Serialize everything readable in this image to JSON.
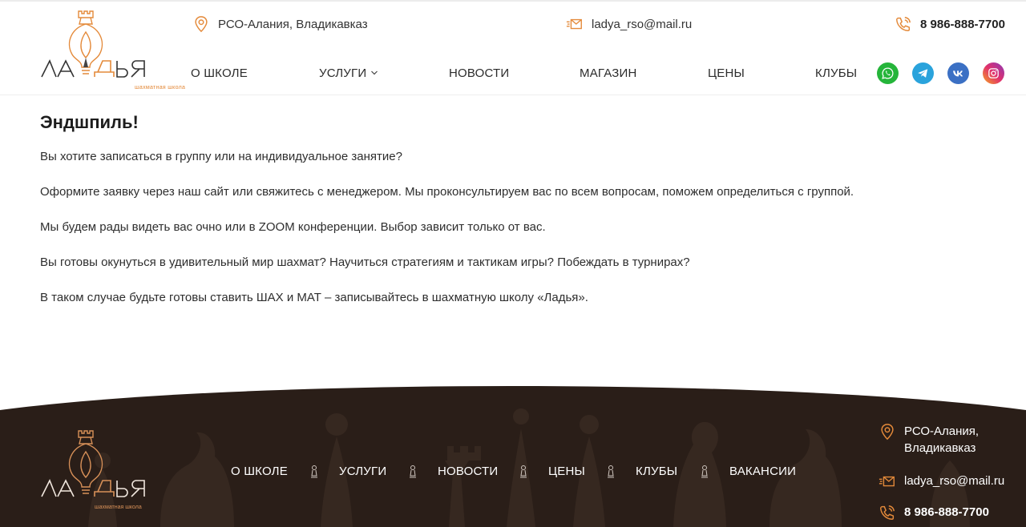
{
  "header": {
    "logo": {
      "brand": "ЛАДЬЯ",
      "tagline": "шахматная школа",
      "accent": "#e48a3a"
    },
    "address": "РСО-Алания, Владикавказ",
    "email": "ladya_rso@mail.ru",
    "phone": "8 986-888-7700",
    "nav": [
      {
        "label": "О ШКОЛЕ"
      },
      {
        "label": "УСЛУГИ",
        "has_dropdown": true
      },
      {
        "label": "НОВОСТИ"
      },
      {
        "label": "МАГАЗИН"
      },
      {
        "label": "ЦЕНЫ"
      },
      {
        "label": "КЛУБЫ"
      }
    ],
    "social": [
      {
        "icon": "whatsapp-icon",
        "color": "#25b53a"
      },
      {
        "icon": "telegram-icon",
        "color": "#2aa3dc"
      },
      {
        "icon": "vk-icon",
        "color": "#3b70c4"
      },
      {
        "icon": "instagram-icon",
        "color": "#d9307a"
      }
    ]
  },
  "main": {
    "title": "Эндшпиль!",
    "paragraphs": [
      "Вы хотите записаться в группу или на индивидуальное занятие?",
      "Оформите заявку через наш сайт или свяжитесь с менеджером. Мы проконсультируем вас по всем вопросам, поможем определиться с группой.",
      "Мы будем рады видеть вас очно или в ZOOM конференции. Выбор зависит только от вас.",
      "Вы готовы окунуться в удивительный мир шахмат? Научиться стратегиям и тактикам игры? Побеждать в турнирах?",
      "В таком случае будьте готовы ставить ШАХ и МАТ – записывайтесь в шахматную школу «Ладья»."
    ]
  },
  "footer": {
    "logo": {
      "brand": "ЛАДЬЯ",
      "tagline": "шахматная школа"
    },
    "nav": [
      {
        "label": "О ШКОЛЕ"
      },
      {
        "label": "УСЛУГИ"
      },
      {
        "label": "НОВОСТИ"
      },
      {
        "label": "ЦЕНЫ"
      },
      {
        "label": "КЛУБЫ"
      },
      {
        "label": "ВАКАНСИИ"
      }
    ],
    "address_line1": "РСО-Алания,",
    "address_line2": "Владикавказ",
    "email": "ladya_rso@mail.ru",
    "phone": "8 986-888-7700",
    "bg_color": "#2a1e18"
  },
  "colors": {
    "accent": "#e48a3a",
    "text": "#2b2b2b",
    "footer_bg": "#2a1e18"
  }
}
